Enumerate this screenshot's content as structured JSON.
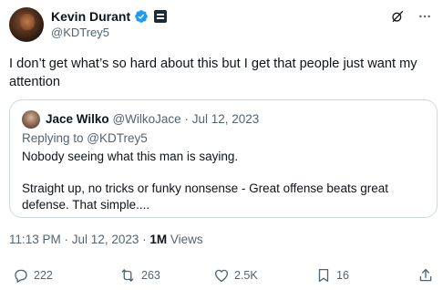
{
  "author": {
    "display_name": "Kevin Durant",
    "handle": "@KDTrey5"
  },
  "tweet": {
    "text": "I don’t get what’s so hard about this but I get that people just want my attention"
  },
  "quote": {
    "display_name": "Jace Wilko",
    "handle": "@WilkoJace",
    "separator": "·",
    "date": "Jul 12, 2023",
    "replying_prefix": "Replying to ",
    "replying_handle": "@KDTrey5",
    "line1": "Nobody seeing what this man is saying.",
    "line2": "Straight up, no tricks or funky nonsense - Great offense beats great defense. That simple...."
  },
  "meta": {
    "time": "11:13 PM",
    "sep1": " · ",
    "date": "Jul 12, 2023",
    "sep2": " · ",
    "views_count": "1M",
    "views_label": " Views"
  },
  "actions": {
    "replies": "222",
    "reposts": "263",
    "likes": "2.5K",
    "bookmarks": "16"
  },
  "colors": {
    "verified_blue": "#1d9bf0",
    "secondary_text": "#536471",
    "border": "#cfd9de"
  },
  "icons": {
    "verified": "verified-badge-icon",
    "affiliate": "affiliate-badge-icon",
    "grok": "grok-icon",
    "more": "more-icon",
    "reply": "reply-icon",
    "repost": "repost-icon",
    "like": "like-icon",
    "bookmark": "bookmark-icon",
    "share": "share-icon"
  }
}
